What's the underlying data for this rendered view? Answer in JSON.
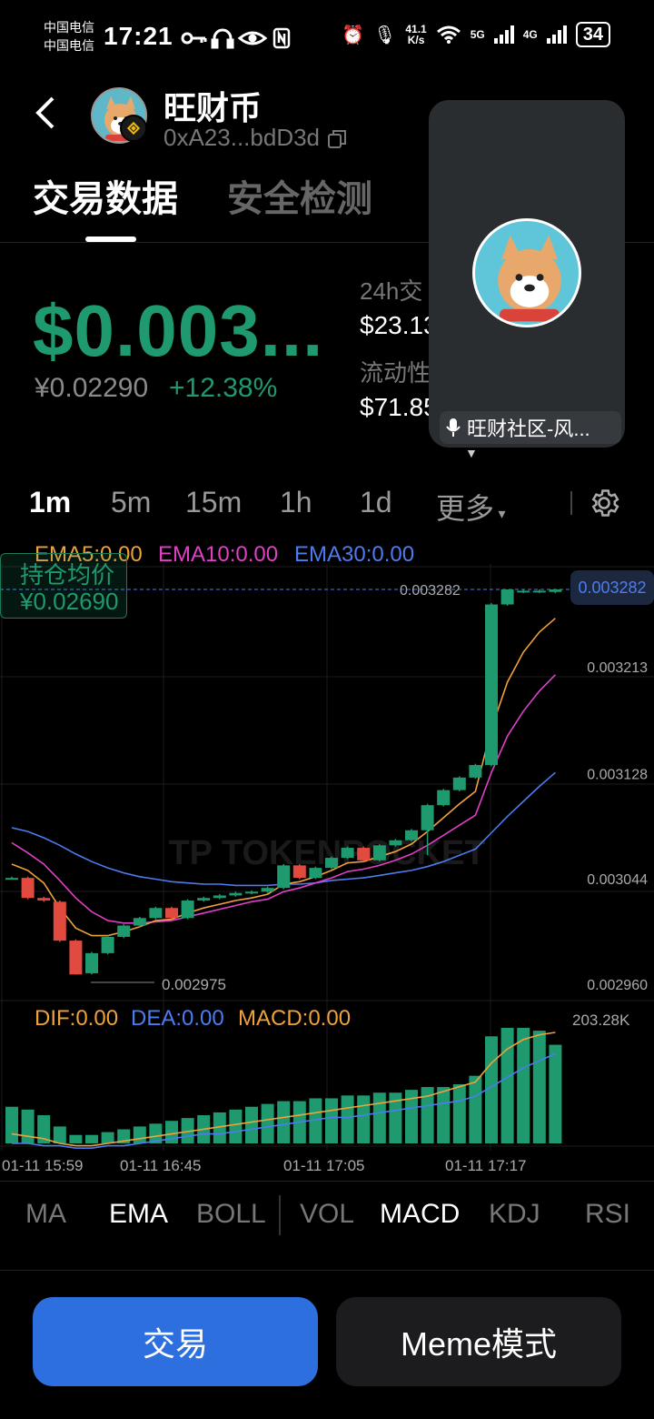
{
  "status_bar": {
    "carrier1": "中国电信",
    "carrier2": "中国电信",
    "time": "17:21",
    "net_speed": "41.1",
    "net_unit": "K/s",
    "sig1": "5G",
    "sig2": "4G",
    "battery": "34"
  },
  "header": {
    "token_name": "旺财币",
    "address": "0xA23...bdD3d"
  },
  "tabs": [
    {
      "label": "交易数据",
      "active": true
    },
    {
      "label": "安全检测",
      "active": false
    }
  ],
  "price": {
    "usd": "$0.003...",
    "cny": "¥0.02290",
    "change": "+12.38%"
  },
  "stats": {
    "vol_label": "24h交",
    "vol_value": "$23.13",
    "liq_label": "流动性",
    "liq_value": "$71.85"
  },
  "overlay": {
    "label": "旺财社区-风..."
  },
  "timeframes": [
    "1m",
    "5m",
    "15m",
    "1h",
    "1d",
    "更多"
  ],
  "active_timeframe": "1m",
  "chart": {
    "ema5": "EMA5:0.00",
    "ema10": "EMA10:0.00",
    "ema30": "EMA30:0.00",
    "avg_label": "持仓均价",
    "avg_value": "¥0.02690",
    "current_price": "0.003282",
    "high_label": "0.003282",
    "low_label": "0.002975",
    "watermark": "TP TOKENPOCKET",
    "dif": "DIF:0.00",
    "dea": "DEA:0.00",
    "macd": "MACD:0.00",
    "vol_max": "203.28K",
    "colors": {
      "up": "#1e9a6e",
      "down": "#e04a3f",
      "ema5": "#f0a23a",
      "ema10": "#e040c8",
      "ema30": "#4d7cf0"
    }
  },
  "chart_data": {
    "type": "candlestick",
    "y_ticks": [
      "0.003282",
      "0.003213",
      "0.003128",
      "0.003044",
      "0.002960"
    ],
    "x_ticks": [
      "01-11 15:59",
      "01-11 16:45",
      "01-11 17:05",
      "01-11 17:17"
    ],
    "ylim": [
      0.00296,
      0.003282
    ],
    "candles": [
      {
        "o": 0.003052,
        "c": 0.003052,
        "h": 0.003053,
        "l": 0.003051
      },
      {
        "o": 0.003052,
        "c": 0.003036,
        "h": 0.003053,
        "l": 0.003035
      },
      {
        "o": 0.003036,
        "c": 0.003034,
        "h": 0.003037,
        "l": 0.003033
      },
      {
        "o": 0.003033,
        "c": 0.003002,
        "h": 0.003034,
        "l": 0.003001
      },
      {
        "o": 0.003002,
        "c": 0.002975,
        "h": 0.003003,
        "l": 0.002975
      },
      {
        "o": 0.002976,
        "c": 0.002992,
        "h": 0.002993,
        "l": 0.002975
      },
      {
        "o": 0.002992,
        "c": 0.003005,
        "h": 0.003006,
        "l": 0.002991
      },
      {
        "o": 0.003005,
        "c": 0.003014,
        "h": 0.003015,
        "l": 0.003004
      },
      {
        "o": 0.003014,
        "c": 0.00302,
        "h": 0.003021,
        "l": 0.003013
      },
      {
        "o": 0.00302,
        "c": 0.003028,
        "h": 0.003029,
        "l": 0.003019
      },
      {
        "o": 0.003028,
        "c": 0.00302,
        "h": 0.003029,
        "l": 0.003019
      },
      {
        "o": 0.00302,
        "c": 0.003034,
        "h": 0.003035,
        "l": 0.003019
      },
      {
        "o": 0.003034,
        "c": 0.003036,
        "h": 0.003037,
        "l": 0.003033
      },
      {
        "o": 0.003036,
        "c": 0.003038,
        "h": 0.003039,
        "l": 0.003035
      },
      {
        "o": 0.003038,
        "c": 0.00304,
        "h": 0.003041,
        "l": 0.003037
      },
      {
        "o": 0.00304,
        "c": 0.003041,
        "h": 0.003042,
        "l": 0.003039
      },
      {
        "o": 0.003041,
        "c": 0.003044,
        "h": 0.003045,
        "l": 0.00304
      },
      {
        "o": 0.003044,
        "c": 0.003062,
        "h": 0.003063,
        "l": 0.003043
      },
      {
        "o": 0.003062,
        "c": 0.003052,
        "h": 0.003063,
        "l": 0.003051
      },
      {
        "o": 0.003052,
        "c": 0.00306,
        "h": 0.003061,
        "l": 0.003051
      },
      {
        "o": 0.00306,
        "c": 0.003068,
        "h": 0.003069,
        "l": 0.003059
      },
      {
        "o": 0.003068,
        "c": 0.003076,
        "h": 0.003077,
        "l": 0.003067
      },
      {
        "o": 0.003076,
        "c": 0.003066,
        "h": 0.003077,
        "l": 0.003065
      },
      {
        "o": 0.003066,
        "c": 0.003078,
        "h": 0.003079,
        "l": 0.003065
      },
      {
        "o": 0.003078,
        "c": 0.003082,
        "h": 0.003083,
        "l": 0.003077
      },
      {
        "o": 0.003082,
        "c": 0.00309,
        "h": 0.003091,
        "l": 0.003081
      },
      {
        "o": 0.00309,
        "c": 0.00311,
        "h": 0.003111,
        "l": 0.00307
      },
      {
        "o": 0.00311,
        "c": 0.003122,
        "h": 0.003123,
        "l": 0.003109
      },
      {
        "o": 0.003122,
        "c": 0.003132,
        "h": 0.003133,
        "l": 0.003121
      },
      {
        "o": 0.003132,
        "c": 0.003142,
        "h": 0.003143,
        "l": 0.003131
      },
      {
        "o": 0.003142,
        "c": 0.00327,
        "h": 0.003271,
        "l": 0.003141
      },
      {
        "o": 0.00327,
        "c": 0.003282,
        "h": 0.003282,
        "l": 0.003269
      },
      {
        "o": 0.00328,
        "c": 0.003281,
        "h": 0.003282,
        "l": 0.003279
      },
      {
        "o": 0.00328,
        "c": 0.003281,
        "h": 0.003282,
        "l": 0.003279
      },
      {
        "o": 0.00328,
        "c": 0.003282,
        "h": 0.003282,
        "l": 0.003279
      }
    ],
    "ema5": [
      0.003063,
      0.003058,
      0.003048,
      0.003028,
      0.003012,
      0.003006,
      0.003006,
      0.003009,
      0.003013,
      0.003018,
      0.003019,
      0.003024,
      0.003028,
      0.003031,
      0.003034,
      0.003036,
      0.003039,
      0.003047,
      0.003049,
      0.003053,
      0.003058,
      0.003064,
      0.003065,
      0.003069,
      0.003073,
      0.003079,
      0.003089,
      0.0031,
      0.003111,
      0.003121,
      0.003171,
      0.003208,
      0.003232,
      0.003248,
      0.003259
    ],
    "ema10": [
      0.00308,
      0.003072,
      0.003063,
      0.00305,
      0.003036,
      0.003025,
      0.003018,
      0.003016,
      0.003016,
      0.003017,
      0.003018,
      0.003021,
      0.003024,
      0.003027,
      0.00303,
      0.003033,
      0.003035,
      0.003041,
      0.003044,
      0.003048,
      0.003052,
      0.003057,
      0.003059,
      0.003062,
      0.003066,
      0.003071,
      0.003078,
      0.003086,
      0.003094,
      0.003102,
      0.003136,
      0.003165,
      0.003185,
      0.003201,
      0.003214
    ],
    "ema30": [
      0.003092,
      0.003089,
      0.003084,
      0.003078,
      0.003071,
      0.003065,
      0.00306,
      0.003056,
      0.003053,
      0.003051,
      0.003049,
      0.003048,
      0.003047,
      0.003047,
      0.003046,
      0.003046,
      0.003046,
      0.003047,
      0.003047,
      0.003048,
      0.00305,
      0.003051,
      0.003052,
      0.003054,
      0.003056,
      0.003058,
      0.003061,
      0.003065,
      0.00307,
      0.003075,
      0.003088,
      0.003101,
      0.003113,
      0.003125,
      0.003136
    ],
    "macd_hist": [
      1.3e-05,
      1.2e-05,
      1e-05,
      6e-06,
      3e-06,
      3e-06,
      4e-06,
      5e-06,
      6e-06,
      7e-06,
      8e-06,
      9e-06,
      1e-05,
      1.1e-05,
      1.2e-05,
      1.3e-05,
      1.4e-05,
      1.5e-05,
      1.5e-05,
      1.6e-05,
      1.6e-05,
      1.7e-05,
      1.7e-05,
      1.8e-05,
      1.8e-05,
      1.9e-05,
      2e-05,
      2e-05,
      2.1e-05,
      2.4e-05,
      3.8e-05,
      4.1e-05,
      4.1e-05,
      4e-05,
      3.5e-05
    ],
    "macd_dif": [
      4e-06,
      3e-06,
      2e-06,
      0.0,
      -1e-06,
      -1e-06,
      0.0,
      1e-06,
      2e-06,
      3e-06,
      4e-06,
      5e-06,
      6e-06,
      7e-06,
      8e-06,
      9e-06,
      1e-05,
      1.1e-05,
      1.2e-05,
      1.3e-05,
      1.4e-05,
      1.5e-05,
      1.6e-05,
      1.7e-05,
      1.8e-05,
      1.9e-05,
      2e-05,
      2.2e-05,
      2.4e-05,
      2.6e-05,
      3.4e-05,
      4e-05,
      4.4e-05,
      4.6e-05,
      4.7e-05
    ],
    "macd_dea": [
      0.0,
      0.0,
      -1e-06,
      -1e-06,
      -2e-06,
      -2e-06,
      -1e-06,
      -1e-06,
      0.0,
      1e-06,
      2e-06,
      3e-06,
      4e-06,
      4e-06,
      5e-06,
      6e-06,
      7e-06,
      8e-06,
      9e-06,
      1e-05,
      1.1e-05,
      1.1e-05,
      1.2e-05,
      1.3e-05,
      1.4e-05,
      1.5e-05,
      1.6e-05,
      1.7e-05,
      1.8e-05,
      2e-05,
      2.4e-05,
      2.8e-05,
      3.2e-05,
      3.5e-05,
      3.8e-05
    ]
  },
  "indicators": [
    {
      "label": "MA",
      "active": false
    },
    {
      "label": "EMA",
      "active": true
    },
    {
      "label": "BOLL",
      "active": false
    },
    {
      "label": "VOL",
      "active": false
    },
    {
      "label": "MACD",
      "active": true
    },
    {
      "label": "KDJ",
      "active": false
    },
    {
      "label": "RSI",
      "active": false
    }
  ],
  "buttons": {
    "trade": "交易",
    "meme": "Meme模式"
  }
}
